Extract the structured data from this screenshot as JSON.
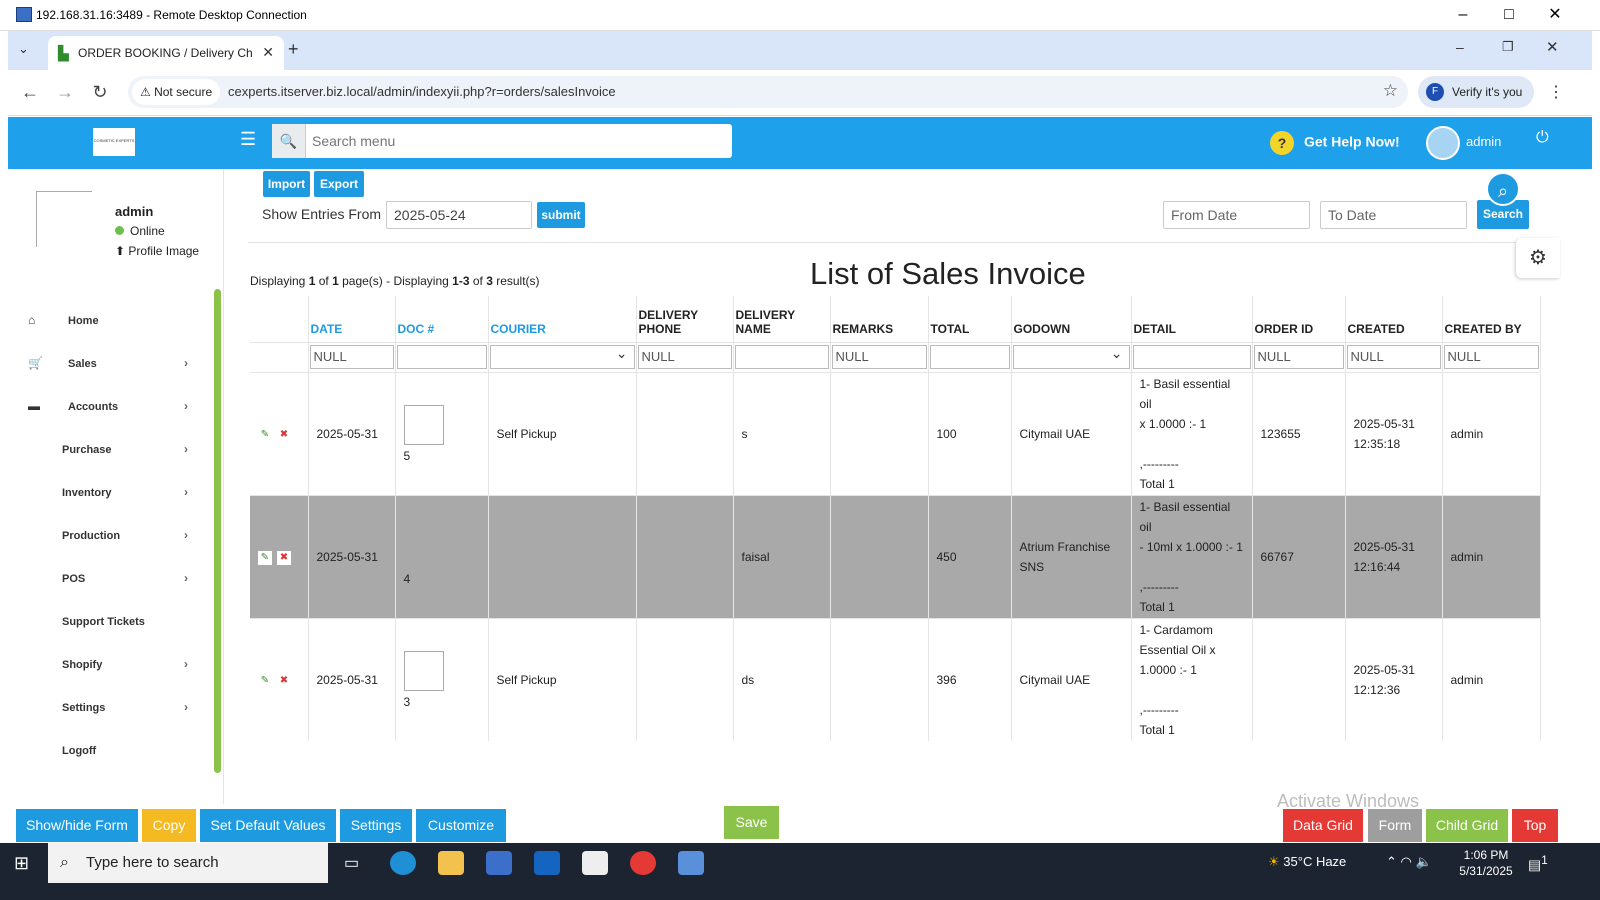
{
  "rdp": {
    "title": "192.168.31.16:3489 - Remote Desktop Connection"
  },
  "browser": {
    "tab_title": "ORDER BOOKING / Delivery Ch",
    "security_label": "Not secure",
    "url": "cexperts.itserver.biz.local/admin/indexyii.php?r=orders/salesInvoice",
    "verify_label": "Verify it's you",
    "verify_avatar": "F"
  },
  "header": {
    "search_placeholder": "Search menu",
    "help_label": "Get Help Now!",
    "user": "admin",
    "logo_text": "COSMETIC EXPERTS"
  },
  "sidebar": {
    "username": "admin",
    "status": "Online",
    "profile_image_label": "Profile Image",
    "items": [
      {
        "label": "Home",
        "icon": "home-icon",
        "has_arrow": false
      },
      {
        "label": "Sales",
        "icon": "cart-icon",
        "has_arrow": true
      },
      {
        "label": "Accounts",
        "icon": "wallet-icon",
        "has_arrow": true
      },
      {
        "label": "Purchase",
        "icon": "",
        "has_arrow": true
      },
      {
        "label": "Inventory",
        "icon": "",
        "has_arrow": true
      },
      {
        "label": "Production",
        "icon": "",
        "has_arrow": true
      },
      {
        "label": "POS",
        "icon": "",
        "has_arrow": true
      },
      {
        "label": "Support Tickets",
        "icon": "",
        "has_arrow": false
      },
      {
        "label": "Shopify",
        "icon": "",
        "has_arrow": true
      },
      {
        "label": "Settings",
        "icon": "",
        "has_arrow": true
      },
      {
        "label": "Logoff",
        "icon": "",
        "has_arrow": false
      }
    ]
  },
  "filters": {
    "import_label": "Import",
    "export_label": "Export",
    "show_entries_label": "Show Entries From",
    "show_entries_value": "2025-05-24",
    "submit_label": "submit",
    "from_date_placeholder": "From Date",
    "to_date_placeholder": "To Date",
    "search_label": "Search"
  },
  "list": {
    "title": "List of Sales Invoice",
    "paging_prefix1": "Displaying ",
    "paging_page": "1",
    "paging_mid1": " of ",
    "paging_pages": "1",
    "paging_mid2": " page(s)   -   Displaying ",
    "paging_range": "1-3",
    "paging_mid3": " of ",
    "paging_total": "3",
    "paging_suffix": " result(s)"
  },
  "table": {
    "headers": [
      "",
      "DATE",
      "DOC #",
      "COURIER",
      "DELIVERY PHONE",
      "DELIVERY NAME",
      "REMARKS",
      "TOTAL",
      "GODOWN",
      "DETAIL",
      "ORDER ID",
      "CREATED",
      "CREATED BY"
    ],
    "filters": [
      "",
      "NULL",
      "",
      "",
      "NULL",
      "",
      "NULL",
      "",
      "",
      "",
      "NULL",
      "NULL",
      "NULL"
    ],
    "rows": [
      {
        "date": "2025-05-31",
        "doc": "5",
        "courier": "Self Pickup",
        "phone": "",
        "name": "s",
        "remarks": "",
        "total": "100",
        "godown": "Citymail UAE",
        "detail_lines": [
          "1- Basil essential oil",
          "x 1.0000 :- 1",
          "",
          ",---------",
          "Total 1"
        ],
        "order_id": "123655",
        "created_date": "2025-05-31",
        "created_time": "12:35:18",
        "created_by": "admin",
        "highlight": false
      },
      {
        "date": "2025-05-31",
        "doc": "4",
        "courier": "",
        "phone": "",
        "name": "faisal",
        "remarks": "",
        "total": "450",
        "godown_lines": [
          "Atrium Franchise",
          "SNS"
        ],
        "detail_lines": [
          "1- Basil essential oil",
          "- 10ml x 1.0000 :- 1",
          "",
          ",---------",
          "Total 1"
        ],
        "order_id": "66767",
        "created_date": "2025-05-31",
        "created_time": "12:16:44",
        "created_by": "admin",
        "highlight": true
      },
      {
        "date": "2025-05-31",
        "doc": "3",
        "courier": "Self Pickup",
        "phone": "",
        "name": "ds",
        "remarks": "",
        "total": "396",
        "godown": "Citymail UAE",
        "detail_lines": [
          "1- Cardamom",
          "Essential Oil x",
          "1.0000 :- 1",
          "",
          ",---------",
          "Total 1"
        ],
        "order_id": "",
        "created_date": "2025-05-31",
        "created_time": "12:12:36",
        "created_by": "admin",
        "highlight": false
      }
    ]
  },
  "toolbar": {
    "show_hide_form": "Show/hide Form",
    "copy": "Copy",
    "set_default": "Set Default Values",
    "settings": "Settings",
    "customize": "Customize",
    "save": "Save",
    "data_grid": "Data Grid",
    "form": "Form",
    "child_grid": "Child Grid",
    "top": "Top"
  },
  "watermark": "Activate Windows",
  "taskbar": {
    "search_placeholder": "Type here to search",
    "weather": "35°C  Haze",
    "time": "1:06 PM",
    "date": "5/31/2025",
    "notification_count": "1"
  },
  "colors": {
    "accent": "#1ea0ea",
    "green": "#8bc34a",
    "copy": "#f5b921",
    "data_grid": "#e53935",
    "form": "#9e9e9e",
    "child_grid": "#8bc34a",
    "top": "#e53935"
  }
}
